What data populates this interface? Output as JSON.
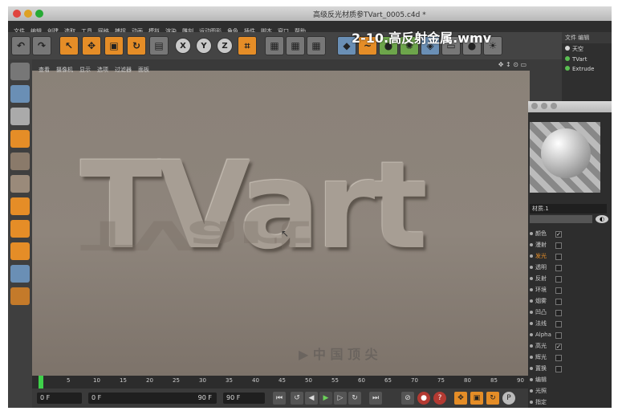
{
  "window": {
    "title": "高级反光材质参TVart_0005.c4d *"
  },
  "overlay_title": "2-10.高反射金属.wmv",
  "menubar": [
    "文件",
    "编辑",
    "创建",
    "选取",
    "工具",
    "网格",
    "捕捉",
    "动画",
    "模拟",
    "渲染",
    "雕刻",
    "运动图形",
    "角色",
    "插件",
    "脚本",
    "窗口",
    "帮助"
  ],
  "toolbar": {
    "buttons": [
      {
        "icon": "undo-icon",
        "glyph": "↶"
      },
      {
        "icon": "redo-icon",
        "glyph": "↷"
      },
      {
        "icon": "select-icon",
        "glyph": "↖"
      },
      {
        "icon": "move-icon",
        "glyph": "✥"
      },
      {
        "icon": "scale-icon",
        "glyph": "▣"
      },
      {
        "icon": "rotate-icon",
        "glyph": "↻"
      },
      {
        "icon": "render-region-icon",
        "glyph": "▤"
      },
      {
        "icon": "x-axis-icon",
        "glyph": "X"
      },
      {
        "icon": "y-axis-icon",
        "glyph": "Y"
      },
      {
        "icon": "z-axis-icon",
        "glyph": "Z"
      },
      {
        "icon": "coordinate-system-icon",
        "glyph": "⌗"
      },
      {
        "icon": "render-view-icon",
        "glyph": "▦"
      },
      {
        "icon": "render-picture-viewer-icon",
        "glyph": "▦"
      },
      {
        "icon": "render-settings-icon",
        "glyph": "▦"
      },
      {
        "icon": "cube-icon",
        "glyph": "◆"
      },
      {
        "icon": "spline-icon",
        "glyph": "~"
      },
      {
        "icon": "generator-icon",
        "glyph": "●"
      },
      {
        "icon": "deformer-icon",
        "glyph": "✺"
      },
      {
        "icon": "scene-icon",
        "glyph": "◈"
      },
      {
        "icon": "floor-icon",
        "glyph": "▭"
      },
      {
        "icon": "camera-icon",
        "glyph": "●"
      },
      {
        "icon": "light-icon",
        "glyph": "☀"
      }
    ]
  },
  "viewport": {
    "menu": [
      "查看",
      "摄像机",
      "显示",
      "选项",
      "过滤器",
      "面板"
    ],
    "hero_text": "TVart"
  },
  "object_manager": {
    "header": [
      "文件",
      "编辑"
    ],
    "items": [
      {
        "label": "天空",
        "dot": "#d8d8d8"
      },
      {
        "label": "TVart",
        "dot": "#5bbf52"
      },
      {
        "label": "Extrude",
        "dot": "#5bbf52"
      }
    ]
  },
  "material": {
    "name": "材质.1",
    "channels": [
      {
        "label": "颜色",
        "checked": true
      },
      {
        "label": "漫射",
        "checked": false
      },
      {
        "label": "发光",
        "checked": false,
        "highlight": true
      },
      {
        "label": "透明",
        "checked": false
      },
      {
        "label": "反射",
        "checked": false
      },
      {
        "label": "环境",
        "checked": false
      },
      {
        "label": "烟雾",
        "checked": false
      },
      {
        "label": "凹凸",
        "checked": false
      },
      {
        "label": "法线",
        "checked": false
      },
      {
        "label": "Alpha",
        "checked": false
      },
      {
        "label": "高光",
        "checked": true
      },
      {
        "label": "辉光",
        "checked": false
      },
      {
        "label": "置换",
        "checked": false
      },
      {
        "label": "编辑",
        "checked": null
      },
      {
        "label": "光照",
        "checked": null
      },
      {
        "label": "指定",
        "checked": null
      }
    ]
  },
  "timeline": {
    "ticks": [
      "0",
      "5",
      "10",
      "15",
      "20",
      "25",
      "30",
      "35",
      "40",
      "45",
      "50",
      "55",
      "60",
      "65",
      "70",
      "75",
      "80",
      "85",
      "90"
    ],
    "current_frame": "0 F",
    "start_field": "0 F",
    "end_field": "90 F",
    "max_field": "90 F"
  },
  "colors": {
    "accent": "#e58d27",
    "play": "#3fd14a",
    "record": "#b43a32"
  }
}
